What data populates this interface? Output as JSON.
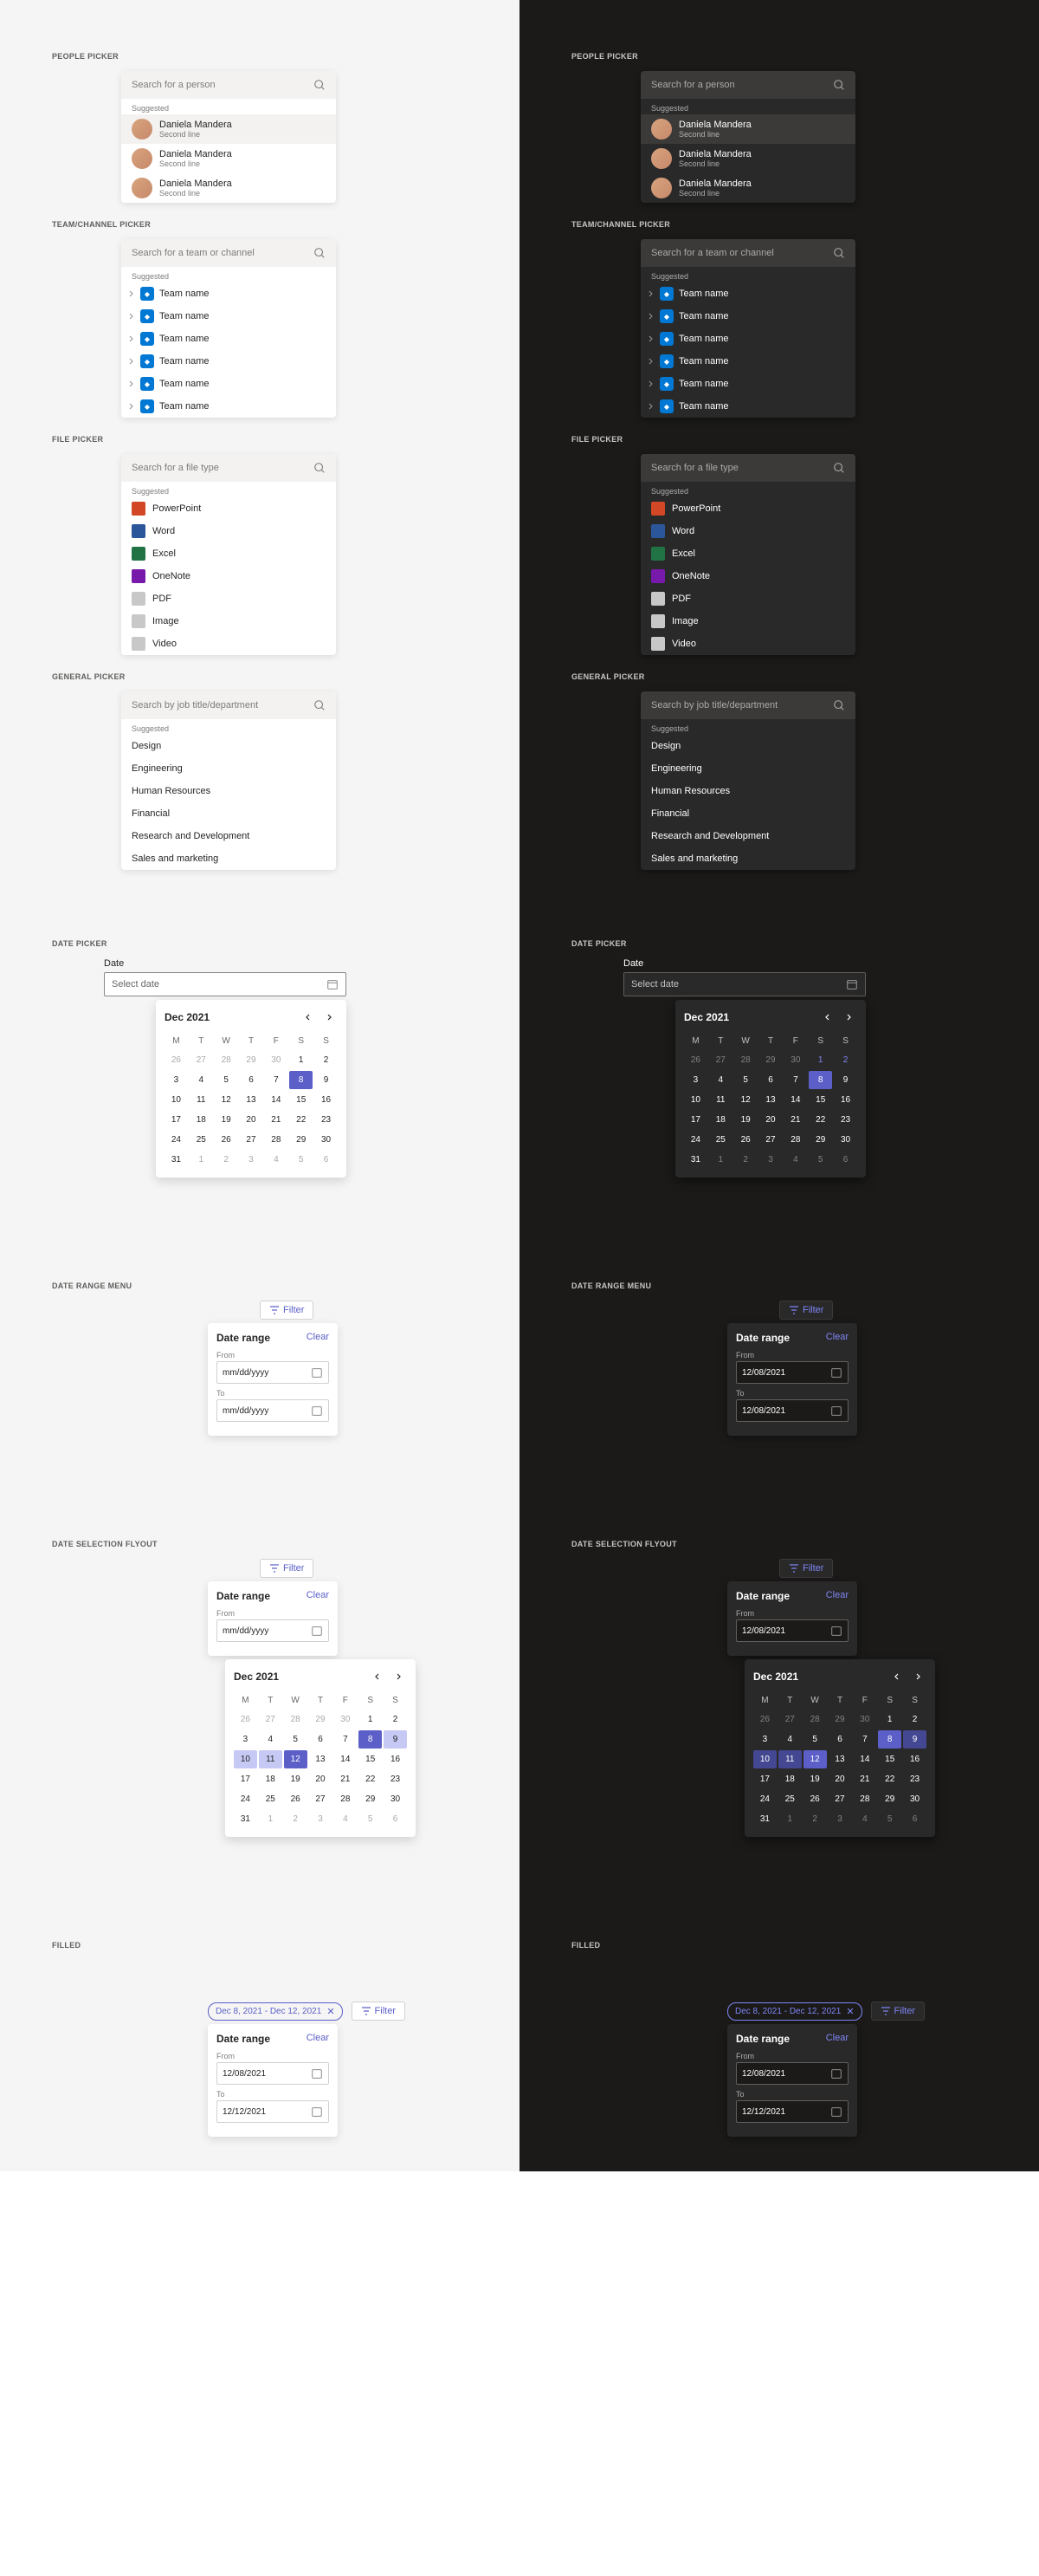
{
  "labels": {
    "people_picker": "PEOPLE PICKER",
    "team_picker": "TEAM/CHANNEL PICKER",
    "file_picker": "FILE PICKER",
    "general_picker": "GENERAL PICKER",
    "date_picker": "DATE PICKER",
    "date_range_menu": "DATE RANGE MENU",
    "date_selection_flyout": "DATE SELECTION FLYOUT",
    "filled": "FILLED",
    "suggested": "Suggested",
    "date": "Date",
    "select_date": "Select date",
    "filter": "Filter",
    "date_range": "Date range",
    "clear": "Clear",
    "from": "From",
    "to": "To",
    "placeholder_date": "mm/dd/yyyy"
  },
  "search": {
    "person": "Search for a person",
    "team": "Search for a team or channel",
    "file": "Search for a file type",
    "general": "Search by job title/department"
  },
  "people": [
    {
      "name": "Daniela Mandera",
      "secondary": "Second line"
    },
    {
      "name": "Daniela Mandera",
      "secondary": "Second line"
    },
    {
      "name": "Daniela Mandera",
      "secondary": "Second line"
    }
  ],
  "teams": [
    {
      "name": "Team name",
      "color": "#0078d4"
    },
    {
      "name": "Team name",
      "color": "#0078d4"
    },
    {
      "name": "Team name",
      "color": "#0078d4"
    },
    {
      "name": "Team name",
      "color": "#0078d4"
    },
    {
      "name": "Team name",
      "color": "#0078d4"
    },
    {
      "name": "Team name",
      "color": "#0078d4"
    }
  ],
  "files": [
    {
      "name": "PowerPoint",
      "color": "#d24726"
    },
    {
      "name": "Word",
      "color": "#2b579a"
    },
    {
      "name": "Excel",
      "color": "#217346"
    },
    {
      "name": "OneNote",
      "color": "#7719aa"
    },
    {
      "name": "PDF",
      "color": "#c8c8c8"
    },
    {
      "name": "Image",
      "color": "#c8c8c8"
    },
    {
      "name": "Video",
      "color": "#c8c8c8"
    }
  ],
  "general": [
    "Design",
    "Engineering",
    "Human Resources",
    "Financial",
    "Research and Development",
    "Sales and marketing"
  ],
  "calendar": {
    "title": "Dec 2021",
    "dow": [
      "M",
      "T",
      "W",
      "T",
      "F",
      "S",
      "S"
    ],
    "days": [
      {
        "n": 26,
        "o": true
      },
      {
        "n": 27,
        "o": true
      },
      {
        "n": 28,
        "o": true
      },
      {
        "n": 29,
        "o": true
      },
      {
        "n": 30,
        "o": true
      },
      {
        "n": 1
      },
      {
        "n": 2
      },
      {
        "n": 3
      },
      {
        "n": 4
      },
      {
        "n": 5
      },
      {
        "n": 6
      },
      {
        "n": 7
      },
      {
        "n": 8,
        "today": true
      },
      {
        "n": 9
      },
      {
        "n": 10
      },
      {
        "n": 11
      },
      {
        "n": 12
      },
      {
        "n": 13
      },
      {
        "n": 14
      },
      {
        "n": 15
      },
      {
        "n": 16
      },
      {
        "n": 17
      },
      {
        "n": 18
      },
      {
        "n": 19
      },
      {
        "n": 20
      },
      {
        "n": 21
      },
      {
        "n": 22
      },
      {
        "n": 23
      },
      {
        "n": 24
      },
      {
        "n": 25
      },
      {
        "n": 26
      },
      {
        "n": 27
      },
      {
        "n": 28
      },
      {
        "n": 29
      },
      {
        "n": 30
      },
      {
        "n": 31
      },
      {
        "n": 1,
        "o": true
      },
      {
        "n": 2,
        "o": true
      },
      {
        "n": 3,
        "o": true
      },
      {
        "n": 4,
        "o": true
      },
      {
        "n": 5,
        "o": true
      },
      {
        "n": 6,
        "o": true
      }
    ]
  },
  "calendar_range": {
    "title": "Dec 2021",
    "days": [
      {
        "n": 26,
        "o": true
      },
      {
        "n": 27,
        "o": true
      },
      {
        "n": 28,
        "o": true
      },
      {
        "n": 29,
        "o": true
      },
      {
        "n": 30,
        "o": true
      },
      {
        "n": 1
      },
      {
        "n": 2
      },
      {
        "n": 3
      },
      {
        "n": 4
      },
      {
        "n": 5
      },
      {
        "n": 6
      },
      {
        "n": 7
      },
      {
        "n": 8,
        "edge": true
      },
      {
        "n": 9,
        "in": true
      },
      {
        "n": 10,
        "in": true
      },
      {
        "n": 11,
        "in": true
      },
      {
        "n": 12,
        "edge": true
      },
      {
        "n": 13
      },
      {
        "n": 14
      },
      {
        "n": 15
      },
      {
        "n": 16
      },
      {
        "n": 17
      },
      {
        "n": 18
      },
      {
        "n": 19
      },
      {
        "n": 20
      },
      {
        "n": 21
      },
      {
        "n": 22
      },
      {
        "n": 23
      },
      {
        "n": 24
      },
      {
        "n": 25
      },
      {
        "n": 26
      },
      {
        "n": 27
      },
      {
        "n": 28
      },
      {
        "n": 29
      },
      {
        "n": 30
      },
      {
        "n": 31
      },
      {
        "n": 1,
        "o": true
      },
      {
        "n": 2,
        "o": true
      },
      {
        "n": 3,
        "o": true
      },
      {
        "n": 4,
        "o": true
      },
      {
        "n": 5,
        "o": true
      },
      {
        "n": 6,
        "o": true
      }
    ]
  },
  "range_values": {
    "from": "12/08/2021",
    "to": "12/08/2021",
    "to_filled": "12/12/2021"
  },
  "pill_text": "Dec 8, 2021 - Dec 12, 2021",
  "dark_cal_highlights": [
    1,
    2
  ]
}
